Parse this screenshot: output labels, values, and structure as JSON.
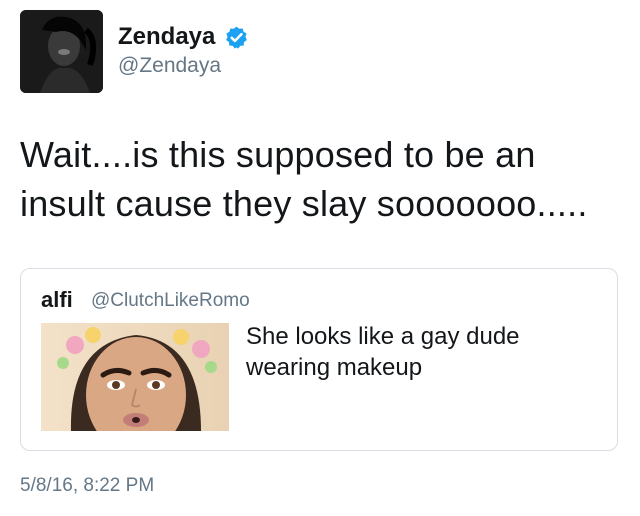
{
  "author": {
    "display_name": "Zendaya",
    "handle": "@Zendaya",
    "verified_icon": "verified-badge-icon",
    "verified_color": "#1da1f2"
  },
  "tweet": {
    "text": "Wait....is this supposed to be an insult cause they slay sooooooo....."
  },
  "quoted_tweet": {
    "display_name": "alfi",
    "handle": "@ClutchLikeRomo",
    "text": "She looks like a gay dude wearing makeup"
  },
  "timestamp": "5/8/16, 8:22 PM",
  "colors": {
    "text": "#14171a",
    "secondary_text": "#657786",
    "border": "#d8dee3"
  }
}
